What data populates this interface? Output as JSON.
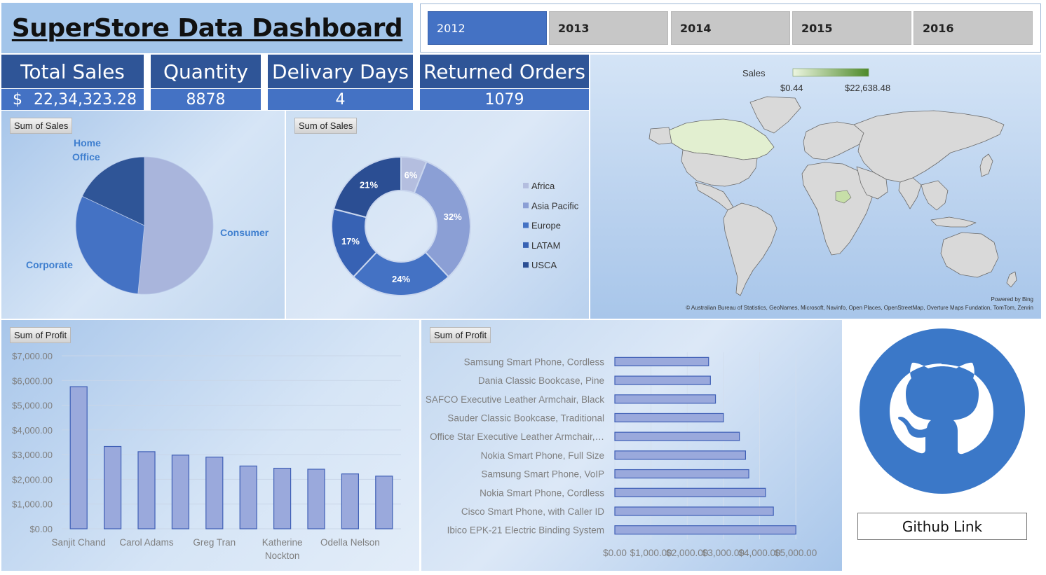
{
  "title": "SuperStore Data Dashboard",
  "years": [
    {
      "label": "2012",
      "active": true
    },
    {
      "label": "2013",
      "active": false
    },
    {
      "label": "2014",
      "active": false
    },
    {
      "label": "2015",
      "active": false
    },
    {
      "label": "2016",
      "active": false
    }
  ],
  "kpis": {
    "total_sales": {
      "label": "Total Sales",
      "currency": "$",
      "value": "22,34,323.28"
    },
    "quantity": {
      "label": "Quantity",
      "value": "8878"
    },
    "delivery_days": {
      "label": "Delivary Days",
      "value": "4"
    },
    "returned_orders": {
      "label": "Returned Orders",
      "value": "1079"
    }
  },
  "colors": {
    "title_bg": "#a3c5ea",
    "kpi_head": "#2f5597",
    "kpi_value": "#4472c4",
    "accent": "#4472c4",
    "slicer_inactive": "#c7c7c7",
    "map_land": "#d9d9d9",
    "map_highlight": "#e2efd0"
  },
  "chart_data": [
    {
      "type": "pie",
      "tag": "Sum of Sales",
      "categories": [
        "Consumer",
        "Corporate",
        "Home Office"
      ],
      "display_labels": [
        "Consumer",
        "Corporate",
        "Home\nOffice"
      ],
      "values": [
        51.5,
        30.5,
        18
      ],
      "colors": [
        "#a9b5dc",
        "#4472c4",
        "#2f5597"
      ]
    },
    {
      "type": "donut",
      "tag": "Sum of Sales",
      "categories": [
        "Africa",
        "Asia Pacific",
        "Europe",
        "LATAM",
        "USCA"
      ],
      "values": [
        6,
        32,
        24,
        17,
        21
      ],
      "value_labels": [
        "6%",
        "32%",
        "24%",
        "17%",
        "21%"
      ],
      "colors": [
        "#b4bedf",
        "#8b9fd5",
        "#4472c4",
        "#3762b4",
        "#2b4e93"
      ],
      "legend": "right"
    },
    {
      "type": "map",
      "legend_title": "Sales",
      "legend_min": "$0.44",
      "legend_max": "$22,638.48",
      "highlighted_regions": [
        "Canada",
        "Central African Republic"
      ],
      "powered_by": "Powered by Bing",
      "attribution": "© Australian Bureau of Statistics, GeoNames, Microsoft, Navinfo, Open Places, OpenStreetMap, Overture Maps Fundation, TomTom, Zenrin"
    },
    {
      "type": "bar",
      "tag": "Sum of Profit",
      "categories": [
        "Sanjit Chand",
        "",
        "Carol Adams",
        "",
        "Greg Tran",
        "",
        "Katherine Nockton",
        "",
        "Odella Nelson",
        ""
      ],
      "x_tick_labels": [
        "Sanjit Chand",
        "Carol Adams",
        "Greg Tran",
        "Katherine\nNockton",
        "Odella Nelson"
      ],
      "values": [
        5750,
        3330,
        3120,
        2980,
        2900,
        2540,
        2450,
        2410,
        2220,
        2130
      ],
      "ylim": [
        0,
        7000
      ],
      "y_ticks": [
        "$0.00",
        "$1,000.00",
        "$2,000.00",
        "$3,000.00",
        "$4,000.00",
        "$5,000.00",
        "$6,000.00",
        "$7,000.00"
      ],
      "grid": true
    },
    {
      "type": "barh",
      "tag": "Sum of Profit",
      "categories": [
        "Samsung Smart Phone, Cordless",
        "Dania Classic Bookcase, Pine",
        "SAFCO Executive Leather Armchair, Black",
        "Sauder Classic Bookcase, Traditional",
        "Office Star Executive Leather Armchair,…",
        "Nokia Smart Phone, Full Size",
        "Samsung Smart Phone, VoIP",
        "Nokia Smart Phone, Cordless",
        "Cisco Smart Phone, with Caller ID",
        "Ibico EPK-21 Electric Binding System"
      ],
      "values": [
        2590,
        2640,
        2780,
        3000,
        3440,
        3610,
        3700,
        4160,
        4380,
        5000
      ],
      "xlim": [
        0,
        5500
      ],
      "x_ticks": [
        "$0.00",
        "$1,000.00",
        "$2,000.00",
        "$3,000.00",
        "$4,000.00",
        "$5,000.00"
      ],
      "grid": true
    }
  ],
  "github": {
    "label": "Github Link",
    "icon": "github-octocat-icon"
  }
}
